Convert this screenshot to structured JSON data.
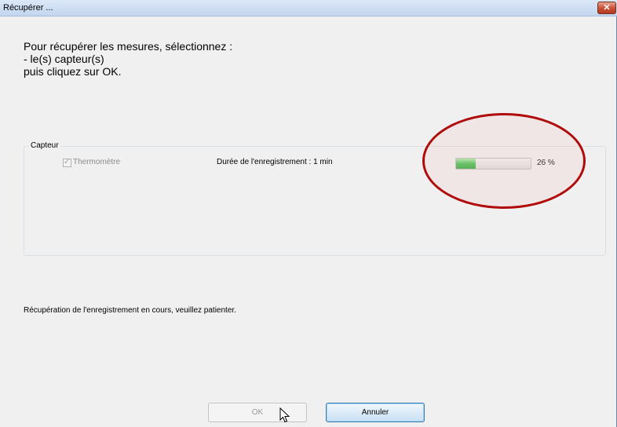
{
  "window": {
    "title": "Récupérer ...",
    "close_label": "✕"
  },
  "instructions": {
    "line1": "Pour récupérer les mesures, sélectionnez :",
    "line2": "- le(s) capteur(s)",
    "line3": "puis cliquez sur OK."
  },
  "sensor_group": {
    "label": "Capteur",
    "sensor": {
      "checked": true,
      "name": "Thermomètre",
      "duration": "Durée de l'enregistrement : 1 min",
      "progress_percent": 26,
      "progress_text": "26 %"
    }
  },
  "status_text": "Récupération de l'enregistrement en cours, veuillez patienter.",
  "buttons": {
    "ok_label": "OK",
    "cancel_label": "Annuler"
  },
  "colors": {
    "progress_green": "#3fc04a",
    "highlight_red": "#b00a0a"
  }
}
